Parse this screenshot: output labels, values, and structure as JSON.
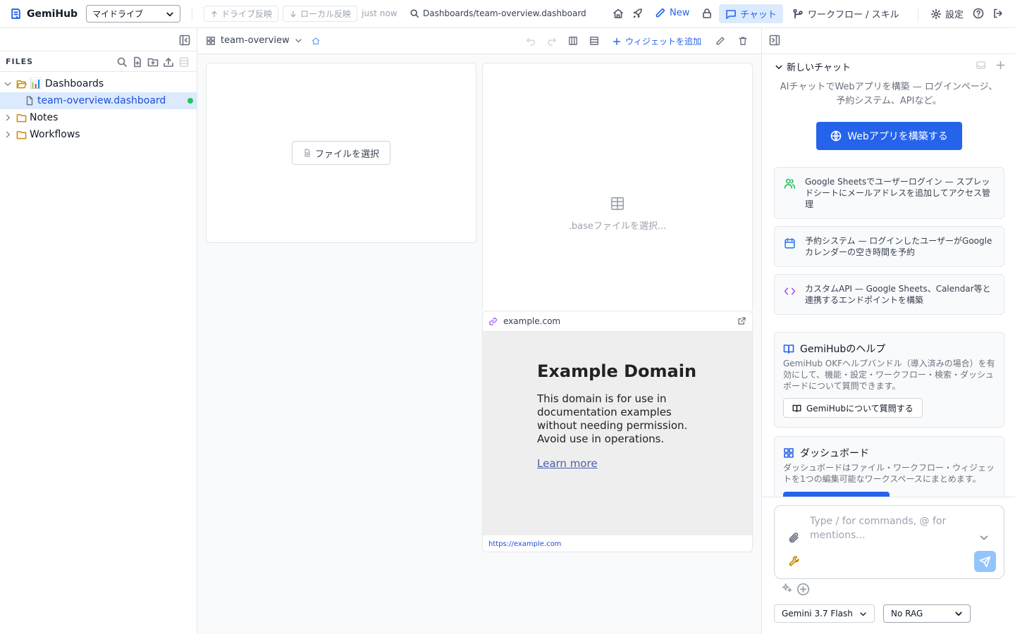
{
  "topbar": {
    "brand": "GemiHub",
    "drive_select": "マイドライブ",
    "push_label": "ドライブ反映",
    "pull_label": "ローカル反映",
    "sync_time": "just now",
    "path": "Dashboards/team-overview.dashboard",
    "new_label": "New",
    "chat_label": "チャット",
    "workflow_label": "ワークフロー / スキル",
    "settings_label": "設定"
  },
  "sidebar": {
    "files_label": "FILES",
    "tree": [
      {
        "name": "📊 Dashboards",
        "type": "folder",
        "expanded": true
      },
      {
        "name": "team-overview.dashboard",
        "type": "file",
        "active": true
      },
      {
        "name": "Notes",
        "type": "folder"
      },
      {
        "name": "Workflows",
        "type": "folder"
      }
    ]
  },
  "main": {
    "dashboard_name": "team-overview",
    "add_widget_label": "ウィジェットを追加",
    "widgets": {
      "file_pick_label": "ファイルを選択",
      "base_placeholder": ".baseファイルを選択...",
      "web": {
        "domain": "example.com",
        "page_title": "Example Domain",
        "page_body": "This domain is for use in documentation examples without needing permission. Avoid use in operations.",
        "page_link": "Learn more",
        "url": "https://example.com"
      }
    }
  },
  "chat": {
    "title": "新しいチャット",
    "intro": "AIチャットでWebアプリを構築 — ログインページ、予約システム、APIなど。",
    "build_label": "Webアプリを構築する",
    "suggestions": [
      {
        "icon": "users-icon",
        "text": "Google Sheetsでユーザーログイン — スプレッドシートにメールアドレスを追加してアクセス管理"
      },
      {
        "icon": "calendar-icon",
        "text": "予約システム — ログインしたユーザーがGoogleカレンダーの空き時間を予約"
      },
      {
        "icon": "code-icon",
        "text": "カスタムAPI — Google Sheets、Calendar等と連携するエンドポイントを構築"
      }
    ],
    "help": {
      "title": "GemiHubのヘルプ",
      "body": "GemiHub OKFヘルプバンドル（導入済みの場合）を有効にして、機能・設定・ワークフロー・検索・ダッシュボードについて質問できます。",
      "button": "GemiHubについて質問する"
    },
    "dashboard_card": {
      "title": "ダッシュボード",
      "body": "ダッシュボードはファイル・ワークフロー・ウィジェットを1つの編集可能なワークスペースにまとめます。"
    },
    "composer_placeholder": "Type / for commands, @ for mentions...",
    "model": "Gemini 3.7 Flash",
    "rag": "No RAG"
  },
  "colors": {
    "accent": "#2563eb",
    "active_bg": "#dbeafe",
    "status_green": "#22c55e"
  }
}
